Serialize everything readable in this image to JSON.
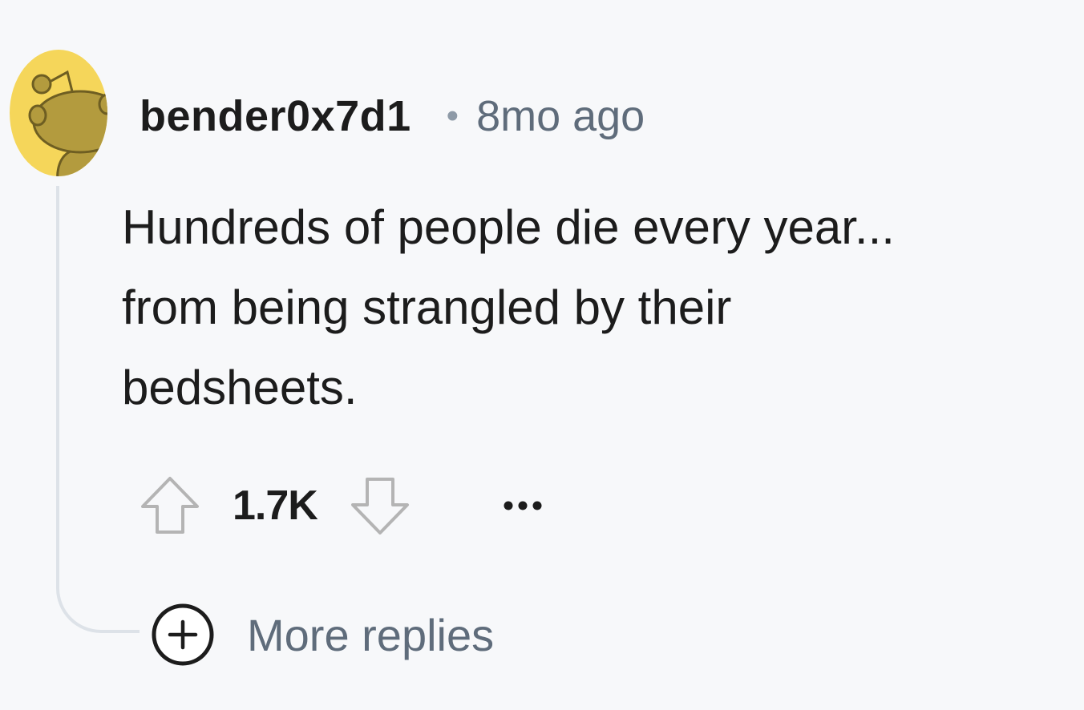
{
  "comment": {
    "username": "bender0x7d1",
    "separator": "•",
    "timestamp": "8mo ago",
    "body_lines": [
      "Hundreds of people die every year...",
      "from being strangled by their",
      "bedsheets."
    ],
    "score": "1.7K",
    "more_replies_label": "More replies"
  },
  "icons": {
    "avatar": "snoo-avatar",
    "upvote": "upvote-arrow-icon",
    "downvote": "downvote-arrow-icon",
    "overflow": "ellipsis-icon",
    "expand": "plus-circle-icon"
  },
  "colors": {
    "background": "#f7f8fa",
    "avatar_bg": "#f5d65a",
    "avatar_figure": "#b39b3e",
    "text_primary": "#1c1c1c",
    "text_secondary": "#5f6c7b",
    "thread_line": "#dde2e8",
    "vote_arrow": "#b4b4b4"
  }
}
